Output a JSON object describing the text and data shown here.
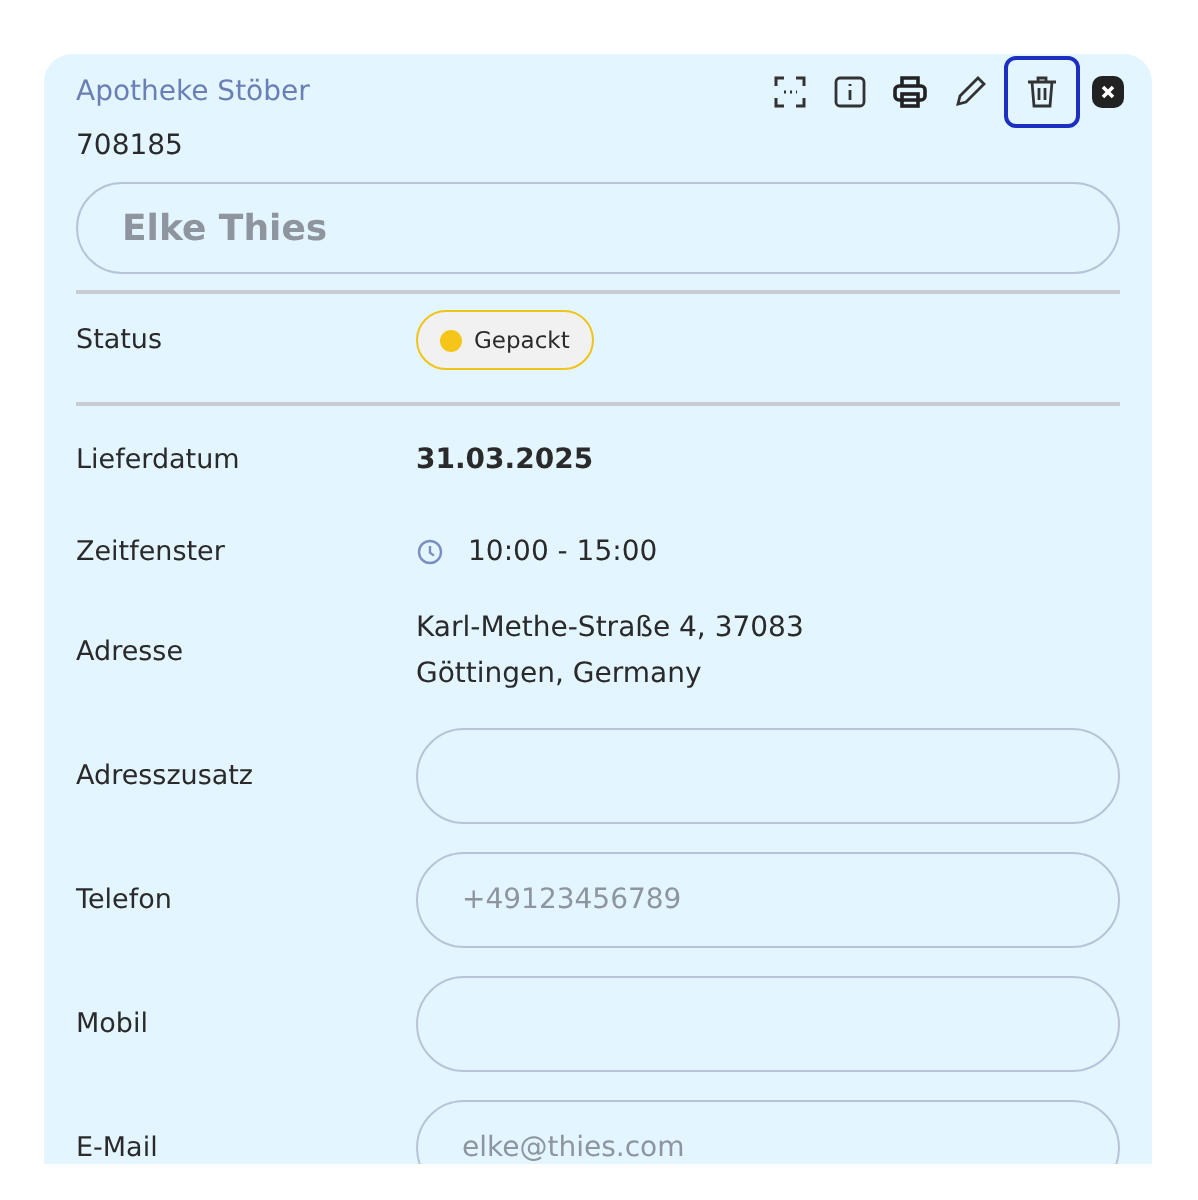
{
  "card": {
    "title": "Apotheke Stöber",
    "number": "708185",
    "actions": [
      {
        "kind": "scan",
        "focused": false
      },
      {
        "kind": "info",
        "focused": false
      },
      {
        "kind": "print",
        "focused": false
      },
      {
        "kind": "edit",
        "focused": false
      },
      {
        "kind": "delete",
        "focused": true
      },
      {
        "kind": "close",
        "focused": false
      }
    ],
    "name_field": {
      "placeholder": "Elke Thies"
    },
    "status": {
      "label": "Status",
      "value": "Gepackt",
      "color": "#f5c518"
    },
    "rows": [
      {
        "kind": "text",
        "label": "Lieferdatum",
        "value": "31.03.2025"
      },
      {
        "kind": "time",
        "label": "Zeitfenster",
        "value": "10:00 - 15:00"
      },
      {
        "kind": "address",
        "label": "Adresse",
        "lines": [
          "Karl-Methe-Straße 4, 37083",
          "Göttingen, Germany"
        ]
      },
      {
        "kind": "field",
        "label": "Adresszusatz"
      },
      {
        "kind": "field",
        "label": "Telefon",
        "placeholder": "+49123456789"
      },
      {
        "kind": "field",
        "label": "Mobil"
      },
      {
        "kind": "field",
        "label": "E-Mail",
        "placeholder": "elke@thies.com"
      }
    ]
  }
}
